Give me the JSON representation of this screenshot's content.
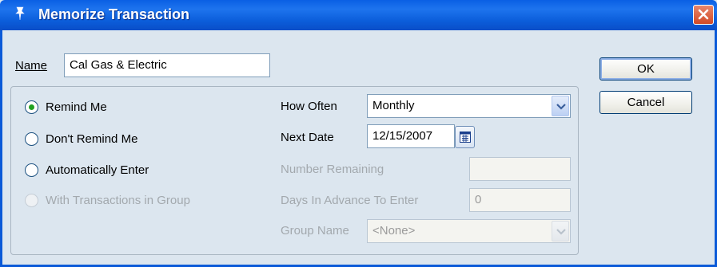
{
  "window": {
    "title": "Memorize Transaction"
  },
  "name_field": {
    "label": "Name",
    "value": "Cal Gas & Electric"
  },
  "reminder": {
    "options": [
      {
        "label": "Remind Me",
        "checked": true,
        "enabled": true
      },
      {
        "label": "Don't Remind Me",
        "checked": false,
        "enabled": true
      },
      {
        "label": "Automatically Enter",
        "checked": false,
        "enabled": true
      },
      {
        "label": "With Transactions in Group",
        "checked": false,
        "enabled": false
      }
    ]
  },
  "schedule": {
    "how_often_label": "How Often",
    "how_often_value": "Monthly",
    "next_date_label": "Next Date",
    "next_date_value": "12/15/2007",
    "number_remaining_label": "Number Remaining",
    "number_remaining_value": "",
    "days_in_advance_label": "Days In Advance To Enter",
    "days_in_advance_value": "0",
    "group_name_label": "Group Name",
    "group_name_value": "<None>"
  },
  "buttons": {
    "ok": "OK",
    "cancel": "Cancel"
  },
  "colors": {
    "title_bar": "#0a5fe4",
    "close_button": "#d24a26",
    "radio_checked": "#21a121"
  }
}
